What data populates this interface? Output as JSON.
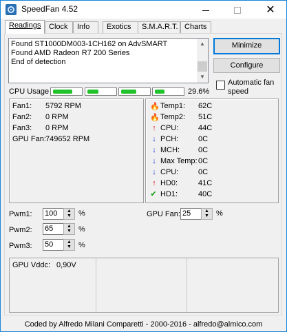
{
  "window": {
    "title": "SpeedFan 4.52",
    "min_glyph": "",
    "close_glyph": "✕"
  },
  "tabs": [
    {
      "label": "Readings",
      "active": true
    },
    {
      "label": "Clock"
    },
    {
      "label": "Info"
    },
    {
      "label": "Exotics"
    },
    {
      "label": "S.M.A.R.T."
    },
    {
      "label": "Charts"
    }
  ],
  "log": {
    "lines": [
      "Found ST1000DM003-1CH162 on AdvSMART",
      "Found AMD Radeon R7 200 Series",
      "End of detection"
    ]
  },
  "buttons": {
    "minimize": "Minimize",
    "configure": "Configure",
    "auto_fan_speed": "Automatic fan speed",
    "auto_fan_checked": false
  },
  "cpu_usage": {
    "label": "CPU Usage",
    "bars": [
      0.7,
      0.4,
      0.55,
      0.35
    ],
    "percent": "29.6%",
    "bar_color": "#22c22c"
  },
  "fans": [
    {
      "label": "Fan1:",
      "value": "5792 RPM"
    },
    {
      "label": "Fan2:",
      "value": "0 RPM"
    },
    {
      "label": "Fan3:",
      "value": "0 RPM"
    },
    {
      "label": "GPU Fan:",
      "value": "749652 RPM"
    }
  ],
  "temps": [
    {
      "icon": "flame",
      "label": "Temp1:",
      "value": "62C"
    },
    {
      "icon": "flame",
      "label": "Temp2:",
      "value": "51C"
    },
    {
      "icon": "arrow-up",
      "label": "CPU:",
      "value": "44C"
    },
    {
      "icon": "arrow-down",
      "label": "PCH:",
      "value": "0C"
    },
    {
      "icon": "arrow-down",
      "label": "MCH:",
      "value": "0C"
    },
    {
      "icon": "arrow-down",
      "label": "Max Temp:",
      "value": "0C"
    },
    {
      "icon": "arrow-down",
      "label": "CPU:",
      "value": "0C"
    },
    {
      "icon": "arrow-up",
      "label": "HD0:",
      "value": "41C"
    },
    {
      "icon": "check",
      "label": "HD1:",
      "value": "40C"
    }
  ],
  "pwm": [
    {
      "label": "Pwm1:",
      "value": "100",
      "unit": "%"
    },
    {
      "label": "Pwm2:",
      "value": "65",
      "unit": "%"
    },
    {
      "label": "Pwm3:",
      "value": "50",
      "unit": "%"
    }
  ],
  "gpu_fan": {
    "label": "GPU Fan:",
    "value": "25",
    "unit": "%"
  },
  "voltages": {
    "label": "GPU Vddc:",
    "value": "0,90V"
  },
  "status": "Coded by Alfredo Milani Comparetti - 2000-2016 - alfredo@almico.com",
  "icons": {
    "flame": "🔥",
    "arrow_up": "↑",
    "arrow_down": "↓",
    "check": "✔",
    "spin_up": "▲",
    "spin_down": "▼",
    "scroll_up": "▲",
    "scroll_down": "▼"
  }
}
